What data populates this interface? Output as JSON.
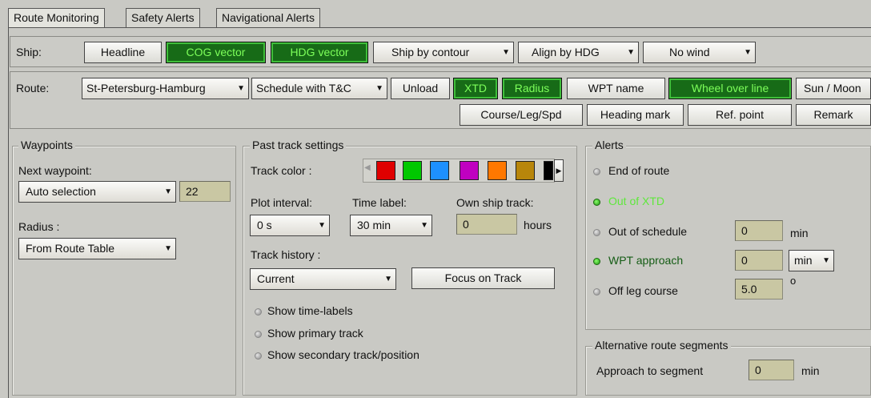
{
  "tabs": [
    "Route Monitoring",
    "Safety Alerts",
    "Navigational Alerts"
  ],
  "ship": {
    "label": "Ship:",
    "headline": "Headline",
    "cog_vector": "COG vector",
    "hdg_vector": "HDG vector",
    "ship_by": "Ship by contour",
    "align_by": "Align by HDG",
    "wind": "No wind"
  },
  "route": {
    "label": "Route:",
    "route_name": "St-Petersburg-Hamburg",
    "schedule": "Schedule with T&C",
    "unload": "Unload",
    "xtd": "XTD",
    "radius": "Radius",
    "wpt_name": "WPT name",
    "wheel_over": "Wheel over line",
    "sun_moon": "Sun / Moon",
    "course_leg": "Course/Leg/Spd",
    "heading_mark": "Heading mark",
    "ref_point": "Ref. point",
    "remark": "Remark"
  },
  "waypoints": {
    "title": "Waypoints",
    "next_label": "Next waypoint:",
    "next_value": "Auto selection",
    "next_number": "22",
    "radius_label": "Radius :",
    "radius_value": "From Route Table"
  },
  "past_track": {
    "title": "Past track settings",
    "color_label": "Track color :",
    "colors": [
      "#e00000",
      "#00c800",
      "#1e90ff",
      "#c000c0",
      "#ff7800",
      "#b8860b",
      "#000000"
    ],
    "plot_interval_label": "Plot interval:",
    "plot_interval_value": "0 s",
    "time_label_label": "Time label:",
    "time_label_value": "30 min",
    "own_ship_label": "Own ship track:",
    "own_ship_value": "0",
    "own_ship_unit": "hours",
    "history_label": "Track history :",
    "history_value": "Current",
    "focus_button": "Focus on Track",
    "show_time_labels": "Show time-labels",
    "show_primary": "Show primary track",
    "show_secondary": "Show secondary track/position"
  },
  "alerts": {
    "title": "Alerts",
    "end_of_route": "End of route",
    "out_of_xtd": "Out of XTD",
    "out_of_schedule": "Out of schedule",
    "out_of_schedule_value": "0",
    "out_of_schedule_unit": "min",
    "wpt_approach": "WPT approach",
    "wpt_approach_value": "0",
    "wpt_approach_unit": "min",
    "off_leg": "Off leg course",
    "off_leg_value": "5.0",
    "off_leg_unit": "o"
  },
  "alt_segments": {
    "title": "Alternative route segments",
    "approach_label": "Approach to segment",
    "approach_value": "0",
    "approach_unit": "min"
  },
  "colors": {
    "active_green_bg": "#176b17",
    "active_green_text": "#7dff5a"
  }
}
